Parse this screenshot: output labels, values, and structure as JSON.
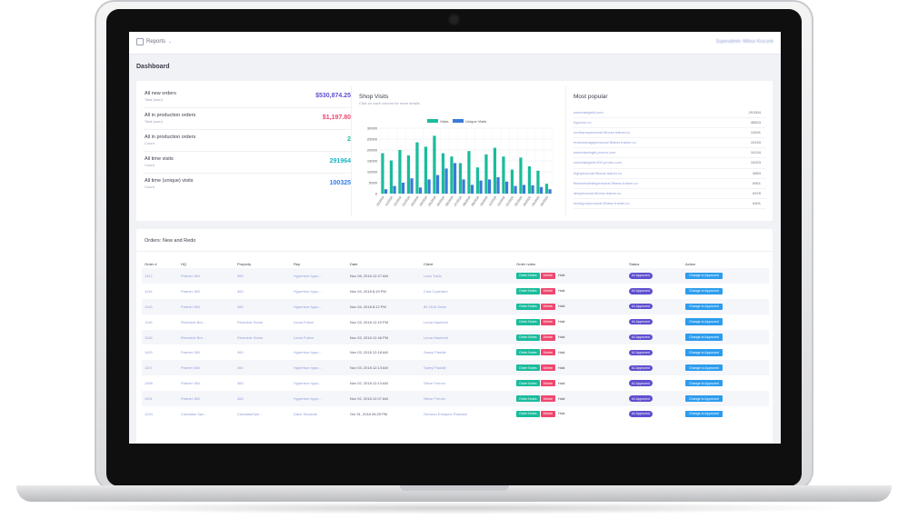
{
  "topbar": {
    "menu_label": "Reports",
    "user": "Superadmin: Milosz Kruczek"
  },
  "page_title": "Dashboard",
  "colors": {
    "accent_purple": "#5e4fd1",
    "teal": "#1abc9c",
    "red": "#ef476f",
    "blue": "#2d9ced"
  },
  "stats": [
    {
      "title": "All new orders",
      "subtitle": "Total (sum)",
      "value": "$530,874.25",
      "color": "#5e4fd1"
    },
    {
      "title": "All in production orders",
      "subtitle": "Total (sum)",
      "value": "$1,197.80",
      "color": "#ef476f"
    },
    {
      "title": "All in production orders",
      "subtitle": "Count",
      "value": "2",
      "color": "#1abc9c"
    },
    {
      "title": "All time visits",
      "subtitle": "Count",
      "value": "291964",
      "color": "#1ab6c8"
    },
    {
      "title": "All time (unique) visits",
      "subtitle": "Count",
      "value": "100325",
      "color": "#2d7ded"
    }
  ],
  "shop_visits": {
    "title": "Shop Visits",
    "subtitle": "Click on each column for more details"
  },
  "chart_data": {
    "type": "bar",
    "legend_position": "top",
    "grid": true,
    "ylim": [
      0,
      30000
    ],
    "yticks": [
      "0",
      "5000",
      "10000",
      "15000",
      "20000",
      "25000",
      "30000"
    ],
    "categories": [
      "10/2015",
      "11/2015",
      "12/2015",
      "01/2016",
      "02/2016",
      "03/2016",
      "04/2016",
      "05/2016",
      "06/2016",
      "07/2016",
      "08/2016",
      "09/2016",
      "10/2016",
      "11/2016",
      "12/2016",
      "01/2017",
      "02/2017",
      "03/2017",
      "04/2017",
      "05/2017",
      "06/2017",
      "07/2017",
      "08/2017",
      "09/2017",
      "10/2017",
      "11/2017",
      "12/2017",
      "01/2018",
      "02/2018",
      "03/2018",
      "04/2018",
      "05/2018",
      "06/2018",
      "07/2018",
      "08/2018",
      "09/2018",
      "10/2018",
      "11/2018",
      "12/2018",
      "01/2019",
      "02/2019",
      "03/2019",
      "04/2019",
      "05/2019",
      "06/2019",
      "07/2019",
      "08/2019",
      "09/2019"
    ],
    "series": [
      {
        "name": "Visits",
        "color": "#1abc9c",
        "values": [
          18500,
          15200,
          20000,
          17500,
          23500,
          21500,
          26500,
          18500,
          17000,
          14000,
          19500,
          12000,
          18000,
          21000,
          17000,
          11000,
          16500,
          12500,
          10500,
          4500
        ]
      },
      {
        "name": "Unique Visits",
        "color": "#3a7bd5",
        "values": [
          2000,
          3500,
          5000,
          7000,
          2800,
          6500,
          8500,
          11500,
          14000,
          6500,
          4000,
          6000,
          6500,
          7500,
          5500,
          3500,
          4000,
          3800,
          3000,
          2000
        ]
      }
    ],
    "xlabels": [
      "10/2018",
      "11/2018",
      "12/2018",
      "01/2019",
      "02/2019",
      "03/2019",
      "04/2019",
      "05/2019",
      "06/2019",
      "07/2019",
      "08/2019",
      "09/2019",
      "10/2019",
      "11/2019",
      "12/2019",
      "01/2020",
      "02/2020",
      "03/2020",
      "04/2020",
      "05/2020"
    ]
  },
  "most_popular": {
    "title": "Most popular",
    "items": [
      {
        "name": "ownedangebt.com",
        "count": "291504"
      },
      {
        "name": "hypemo.co",
        "count": "48503"
      },
      {
        "name": "northamspersonal fitness trainer.co",
        "count": "13491"
      },
      {
        "name": "mostmonagepersonal fitness trainer.co",
        "count": "10153"
      },
      {
        "name": "ownedswingbt.promo.com",
        "count": "10134"
      },
      {
        "name": "ownedangebt.000.promo.com",
        "count": "10023"
      },
      {
        "name": "highpersonal fitness trainer.co",
        "count": "9853"
      },
      {
        "name": "fitnessfoothillspersonal fitness trainer.co",
        "count": "8901"
      },
      {
        "name": "abbpersonal fitness trainer.co",
        "count": "6978"
      },
      {
        "name": "lovelypurpersonal fitness trainer.co",
        "count": "6401"
      }
    ]
  },
  "orders": {
    "title": "Orders: New and Redo",
    "columns": [
      "Order #",
      "HQ",
      "Property",
      "Rep",
      "Date",
      "Client",
      "Order notes",
      "Status",
      "Action"
    ],
    "notes_label": "Order Notes",
    "delete_label": "Delete",
    "hold_label": "Hold",
    "action_label": "Change to Approved",
    "rows": [
      {
        "order": "1317",
        "hq": "Partner 360",
        "property": "360",
        "rep": "Hypertrue hypo...",
        "date": "Nov 08, 2018 12:27 AM",
        "client": "Lado Tuldo",
        "status": "#1 Approved"
      },
      {
        "order": "1144",
        "hq": "Partner 360",
        "property": "360",
        "rep": "Hypertrue hypo...",
        "date": "Nov 04, 2018 8:19 PM",
        "client": "Cola Copeland",
        "status": "#1 Approved"
      },
      {
        "order": "1143",
        "hq": "Partner 360",
        "property": "360",
        "rep": "Hypertrue hypo...",
        "date": "Nov 04, 2018 8:12 PM",
        "client": "80 1818 Drive",
        "status": "#1 Approved"
      },
      {
        "order": "1146",
        "hq": "Riverside Bro...",
        "property": "Riverside Stone",
        "rep": "Linda Fulton",
        "date": "Nov 03, 2018 12:10 PM",
        "client": "Lema Hashemi",
        "status": "#1 Approved"
      },
      {
        "order": "1145",
        "hq": "Riverside Bro...",
        "property": "Riverside Stone",
        "rep": "Linda Fulton",
        "date": "Nov 03, 2018 12:46 PM",
        "client": "Lema Hashemi",
        "status": "#1 Approved"
      },
      {
        "order": "1109",
        "hq": "Partner 360",
        "property": "360",
        "rep": "Hypertrue hypo...",
        "date": "Nov 03, 2018 12:18 AM",
        "client": "Samyl Paddle",
        "status": "#1 Approved"
      },
      {
        "order": "1107",
        "hq": "Partner 360",
        "property": "360",
        "rep": "Hypertrue hypo...",
        "date": "Nov 03, 2018 12:13 AM",
        "client": "Samyl Paddle",
        "status": "#1 Approved"
      },
      {
        "order": "1005",
        "hq": "Partner 360",
        "property": "360",
        "rep": "Hypertrue hypo...",
        "date": "Nov 02, 2018 12:13 AM",
        "client": "Steve French",
        "status": "#1 Approved"
      },
      {
        "order": "1001",
        "hq": "Partner 360",
        "property": "360",
        "rep": "Hypertrue hypo...",
        "date": "Nov 02, 2018 12:07 AM",
        "client": "Steve French",
        "status": "#1 Approved"
      },
      {
        "order": "1024",
        "hq": "Canadian Spri...",
        "property": "CanadianSpri...",
        "rep": "Dave Sowards",
        "date": "Oct 31, 2018 06:29 PM",
        "client": "Gerardo Enriquez Palacios",
        "status": "#1 Approved"
      }
    ]
  }
}
